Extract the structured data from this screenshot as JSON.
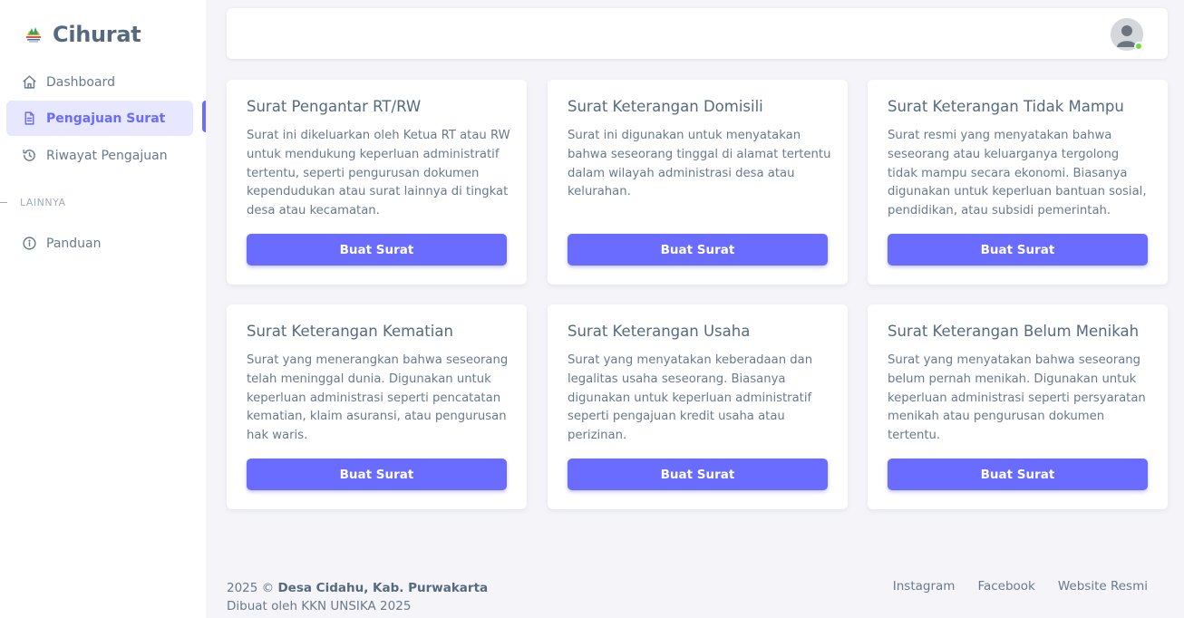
{
  "brand": {
    "name": "Cihurat"
  },
  "sidebar": {
    "items": [
      {
        "label": "Dashboard",
        "icon": "home-icon",
        "active": false
      },
      {
        "label": "Pengajuan Surat",
        "icon": "file-text-icon",
        "active": true
      },
      {
        "label": "Riwayat Pengajuan",
        "icon": "history-icon",
        "active": false
      }
    ],
    "section_header": "LAINNYA",
    "extra_items": [
      {
        "label": "Panduan",
        "icon": "info-circle-icon"
      }
    ]
  },
  "navbar": {
    "avatar": "user-avatar-icon",
    "status_color": "#71dd37"
  },
  "cards": [
    {
      "title": "Surat Pengantar RT/RW",
      "description": "Surat ini dikeluarkan oleh Ketua RT atau RW untuk mendukung keperluan administratif tertentu, seperti pengurusan dokumen kependudukan atau surat lainnya di tingkat desa atau kecamatan.",
      "button": "Buat Surat"
    },
    {
      "title": "Surat Keterangan Domisili",
      "description": "Surat ini digunakan untuk menyatakan bahwa seseorang tinggal di alamat tertentu dalam wilayah administrasi desa atau kelurahan.",
      "button": "Buat Surat"
    },
    {
      "title": "Surat Keterangan Tidak Mampu",
      "description": "Surat resmi yang menyatakan bahwa seseorang atau keluarganya tergolong tidak mampu secara ekonomi. Biasanya digunakan untuk keperluan bantuan sosial, pendidikan, atau subsidi pemerintah.",
      "button": "Buat Surat"
    },
    {
      "title": "Surat Keterangan Kematian",
      "description": "Surat yang menerangkan bahwa seseorang telah meninggal dunia. Digunakan untuk keperluan administrasi seperti pencatatan kematian, klaim asuransi, atau pengurusan hak waris.",
      "button": "Buat Surat"
    },
    {
      "title": "Surat Keterangan Usaha",
      "description": "Surat yang menyatakan keberadaan dan legalitas usaha seseorang. Biasanya digunakan untuk keperluan administratif seperti pengajuan kredit usaha atau perizinan.",
      "button": "Buat Surat"
    },
    {
      "title": "Surat Keterangan Belum Menikah",
      "description": "Surat yang menyatakan bahwa seseorang belum pernah menikah. Digunakan untuk keperluan administrasi seperti persyaratan menikah atau pengurusan dokumen tertentu.",
      "button": "Buat Surat"
    }
  ],
  "footer": {
    "year_prefix": "2025 ©",
    "org": "Desa Cidahu, Kab. Purwakarta",
    "credit": "Dibuat oleh KKN UNSIKA 2025",
    "links": [
      "Instagram",
      "Facebook",
      "Website Resmi"
    ]
  },
  "colors": {
    "primary": "#696cff",
    "active_bg": "#e7e7ff",
    "page_bg": "#f5f5f9"
  }
}
